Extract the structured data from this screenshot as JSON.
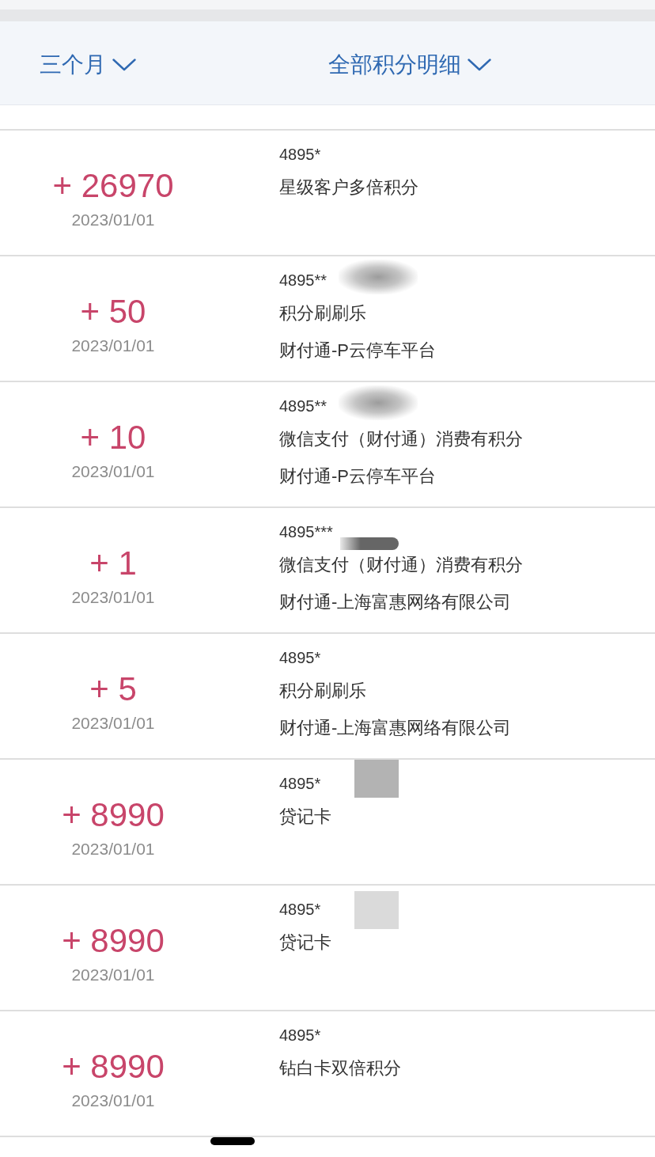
{
  "filters": [
    {
      "label": "三个月"
    },
    {
      "label": "全部积分明细"
    }
  ],
  "records": [
    {
      "points": "+ 26970",
      "date": "2023/01/01",
      "card": "4895*",
      "description": "星级客户多倍积分"
    },
    {
      "points": "+ 50",
      "date": "2023/01/01",
      "card": "4895**",
      "description": "积分刷刷乐",
      "merchant": "财付通-P云停车平台",
      "redaction": {
        "kind": "smudge"
      }
    },
    {
      "points": "+ 10",
      "date": "2023/01/01",
      "card": "4895**",
      "description": "微信支付（财付通）消费有积分",
      "merchant": "财付通-P云停车平台",
      "redaction": {
        "kind": "smudge"
      }
    },
    {
      "points": "+ 1",
      "date": "2023/01/01",
      "card": "4895***",
      "description": "微信支付（财付通）消费有积分",
      "merchant": "财付通-上海富惠网络有限公司",
      "redaction": {
        "kind": "bar"
      }
    },
    {
      "points": "+ 5",
      "date": "2023/01/01",
      "card": "4895*",
      "description": "积分刷刷乐",
      "merchant": "财付通-上海富惠网络有限公司"
    },
    {
      "points": "+ 8990",
      "date": "2023/01/01",
      "card": "4895*",
      "description": "贷记卡",
      "redaction": {
        "kind": "dark"
      }
    },
    {
      "points": "+ 8990",
      "date": "2023/01/01",
      "card": "4895*",
      "description": "贷记卡",
      "redaction": {
        "kind": "light"
      }
    },
    {
      "points": "+ 8990",
      "date": "2023/01/01",
      "card": "4895*",
      "description": "钻白卡双倍积分"
    }
  ]
}
